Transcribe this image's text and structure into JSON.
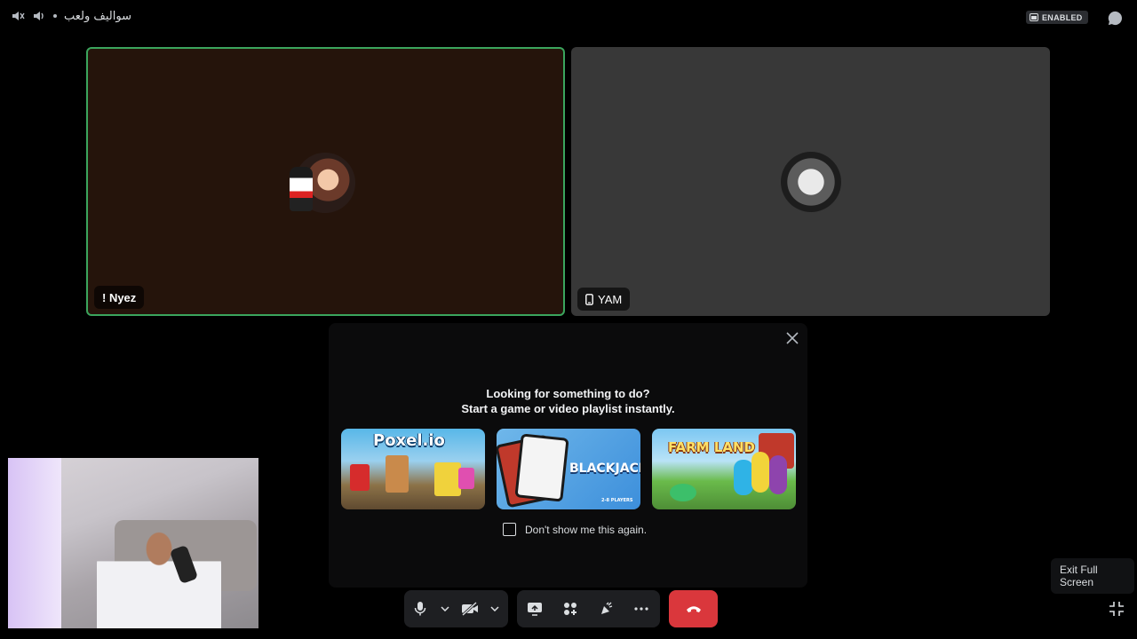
{
  "topbar": {
    "channel_title": "سواليف ولعب",
    "badge_label": "ENABLED"
  },
  "participants": [
    {
      "name": "! Nyez",
      "speaking": true
    },
    {
      "name": "YAM",
      "speaking": false
    }
  ],
  "activity_panel": {
    "line1": "Looking for something to do?",
    "line2": "Start a game or video playlist instantly.",
    "games": [
      {
        "title": "Poxel.io"
      },
      {
        "title": "BLACKJACK",
        "subtitle": "2-8 PLAYERS"
      },
      {
        "title": "FARM LAND"
      }
    ],
    "checkbox_label": "Don't show me this again."
  },
  "tooltip": {
    "text": "Exit Full Screen"
  },
  "colors": {
    "speaking_border": "#3ba55d",
    "end_call": "#da373c",
    "panel_bg": "#0b0b0c"
  },
  "icons": [
    "speaker-icon",
    "volume-icon",
    "activity-badge-icon",
    "chat-icon",
    "close-icon",
    "phone-icon",
    "mic-icon",
    "chevron-down-icon",
    "camera-off-icon",
    "screen-share-icon",
    "activities-icon",
    "soundboard-icon",
    "more-icon",
    "end-call-icon",
    "exit-fullscreen-icon"
  ]
}
